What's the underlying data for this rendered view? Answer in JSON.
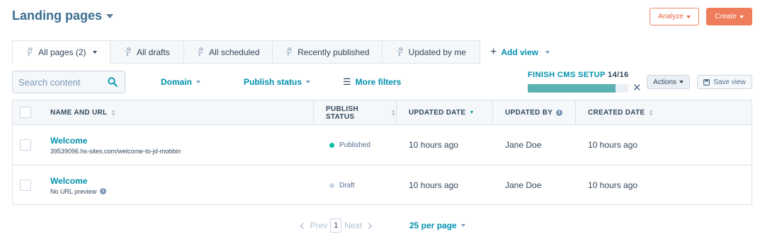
{
  "header": {
    "title": "Landing pages",
    "analyze_label": "Analyze",
    "create_label": "Create"
  },
  "tabs": [
    {
      "label": "All pages (2)",
      "active": true
    },
    {
      "label": "All drafts"
    },
    {
      "label": "All scheduled"
    },
    {
      "label": "Recently published"
    },
    {
      "label": "Updated by me"
    }
  ],
  "add_view_label": "Add view",
  "search": {
    "placeholder": "Search content",
    "value": ""
  },
  "filters": {
    "domain": "Domain",
    "publish_status": "Publish status",
    "more_filters": "More filters"
  },
  "cms_setup": {
    "label": "FINISH CMS SETUP",
    "count": "14/16",
    "progress": 0.875
  },
  "toolbar": {
    "actions_label": "Actions",
    "save_view_label": "Save view"
  },
  "table": {
    "columns": [
      "NAME AND URL",
      "PUBLISH STATUS",
      "UPDATED DATE",
      "UPDATED BY",
      "CREATED DATE"
    ],
    "rows": [
      {
        "name": "Welcome",
        "url": "39539096.hs-sites.com/welcome-to-jd-mobbin",
        "status": "Published",
        "status_color": "#00bda5",
        "updated_date": "10 hours ago",
        "updated_by": "Jane Doe",
        "created_date": "10 hours ago"
      },
      {
        "name": "Welcome",
        "url": "No URL preview",
        "status": "Draft",
        "status_color": "#cbd6e2",
        "updated_date": "10 hours ago",
        "updated_by": "Jane Doe",
        "created_date": "10 hours ago"
      }
    ]
  },
  "pagination": {
    "prev_label": "Prev",
    "current_page": "1",
    "next_label": "Next",
    "per_page_label": "25 per page"
  },
  "colors": {
    "accent": "#0091ae",
    "brand_orange": "#ef7c5a",
    "title": "#3a6e8f",
    "progress_fill": "#5ab2b0"
  }
}
